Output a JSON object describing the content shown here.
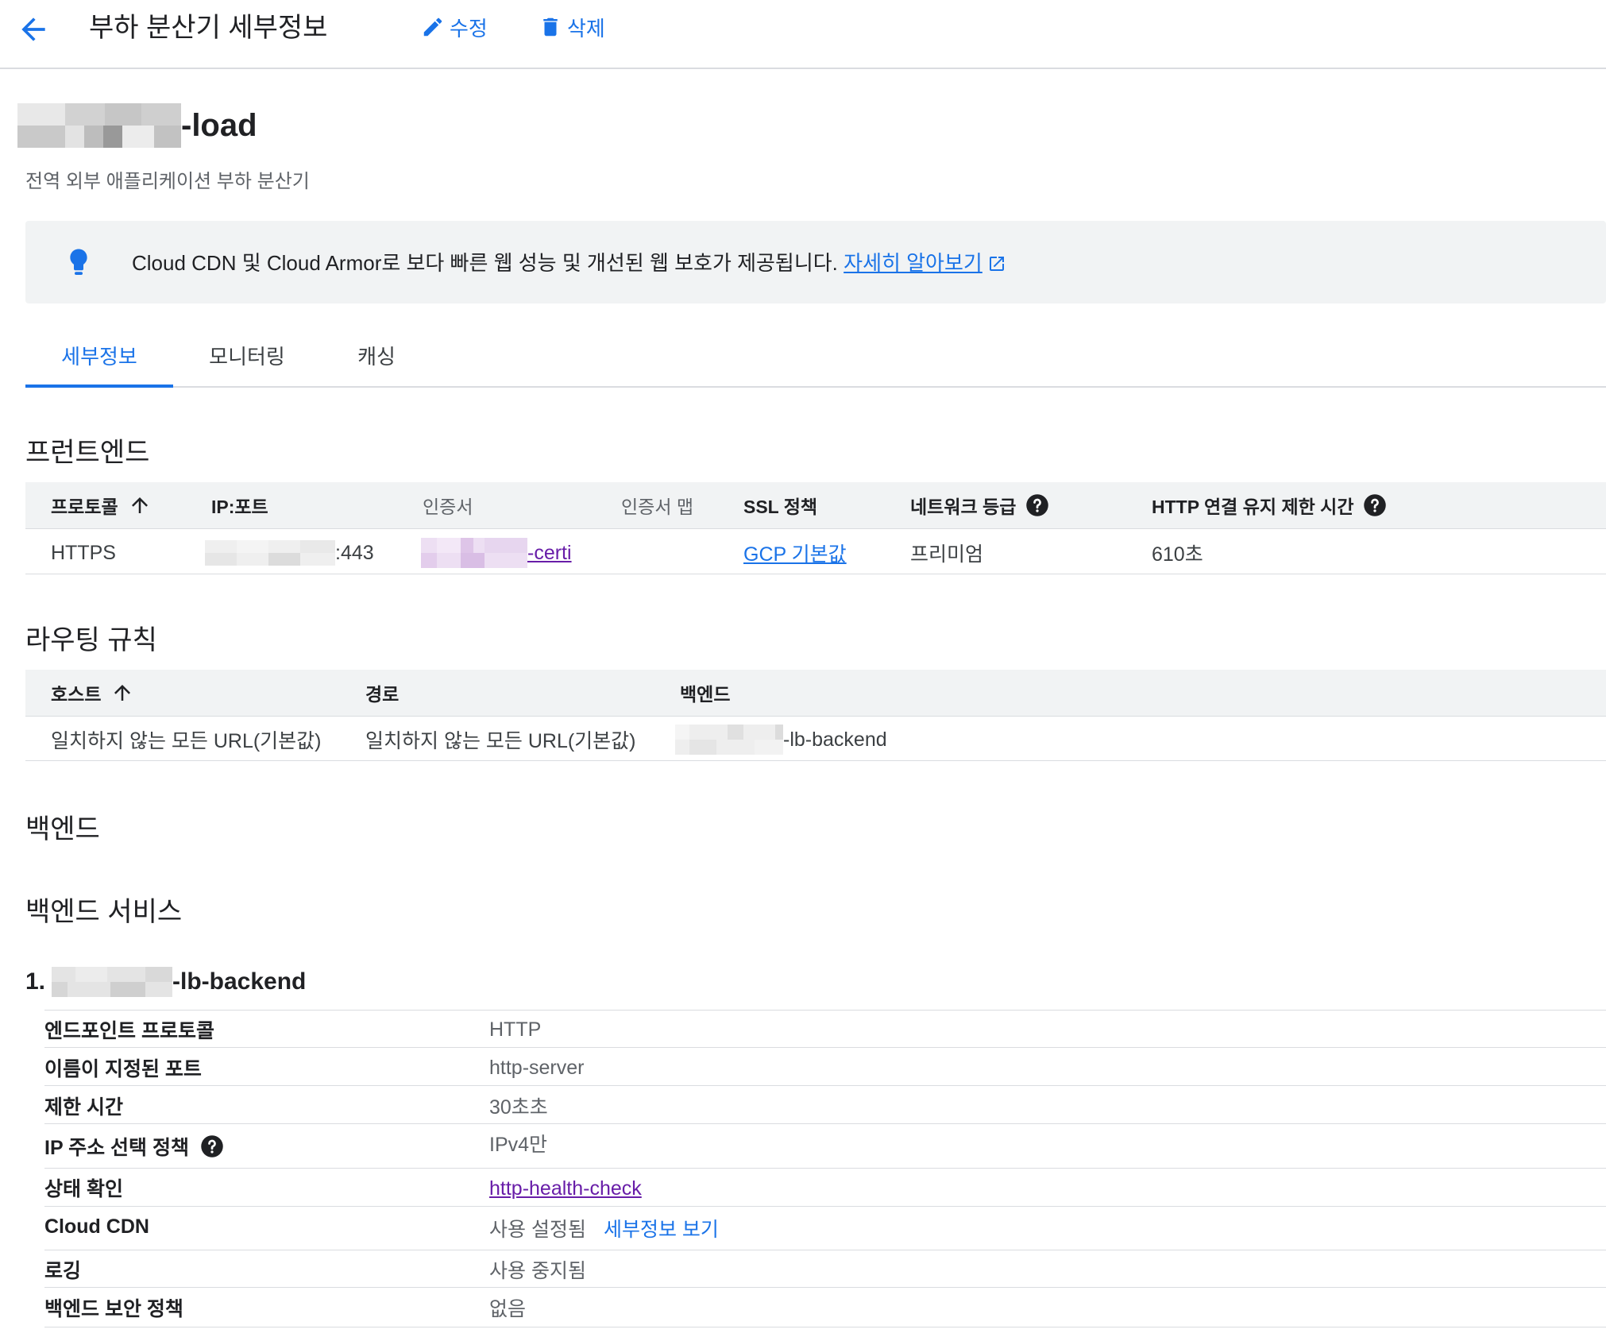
{
  "header": {
    "title": "부하 분산기 세부정보",
    "edit_label": "수정",
    "delete_label": "삭제"
  },
  "load_balancer": {
    "name_suffix": "-load",
    "type": "전역 외부 애플리케이션 부하 분산기"
  },
  "banner": {
    "text": "Cloud CDN 및 Cloud Armor로 보다 빠른 웹 성능 및 개선된 웹 보호가 제공됩니다.",
    "link": "자세히 알아보기"
  },
  "tabs": [
    {
      "label": "세부정보",
      "active": true
    },
    {
      "label": "모니터링",
      "active": false
    },
    {
      "label": "캐싱",
      "active": false
    }
  ],
  "frontend": {
    "heading": "프런트엔드",
    "columns": [
      "프로토콜",
      "IP:포트",
      "인증서",
      "인증서 맵",
      "SSL 정책",
      "네트워크 등급",
      "HTTP 연결 유지 제한 시간"
    ],
    "row": {
      "protocol": "HTTPS",
      "ip_port_suffix": ":443",
      "certificate_suffix": "-certi",
      "certificate_map": "",
      "ssl_policy": "GCP 기본값",
      "network_tier": "프리미엄",
      "keepalive_timeout": "610초"
    }
  },
  "routing": {
    "heading": "라우팅 규칙",
    "columns": [
      "호스트",
      "경로",
      "백엔드"
    ],
    "row": {
      "host": "일치하지 않는 모든 URL(기본값)",
      "path": "일치하지 않는 모든 URL(기본값)",
      "backend_suffix": "-lb-backend"
    }
  },
  "backend": {
    "heading": "백엔드",
    "services_heading": "백엔드 서비스",
    "service_index": "1.",
    "service_name_suffix": "-lb-backend",
    "details": [
      {
        "key": "엔드포인트 프로토콜",
        "value": "HTTP"
      },
      {
        "key": "이름이 지정된 포트",
        "value": "http-server"
      },
      {
        "key": "제한 시간",
        "value": "30초초"
      },
      {
        "key": "IP 주소 선택 정책",
        "value": "IPv4만"
      },
      {
        "key": "상태 확인",
        "value": "http-health-check"
      },
      {
        "key": "Cloud CDN",
        "value": "사용 설정됨",
        "link": "세부정보 보기"
      },
      {
        "key": "로깅",
        "value": "사용 중지됨"
      },
      {
        "key": "백엔드 보안 정책",
        "value": "없음"
      }
    ]
  },
  "colors": {
    "accent": "#1a73e8",
    "visited_link": "#681da8",
    "banner_bg": "#f1f3f4",
    "divider": "#dadce0"
  }
}
